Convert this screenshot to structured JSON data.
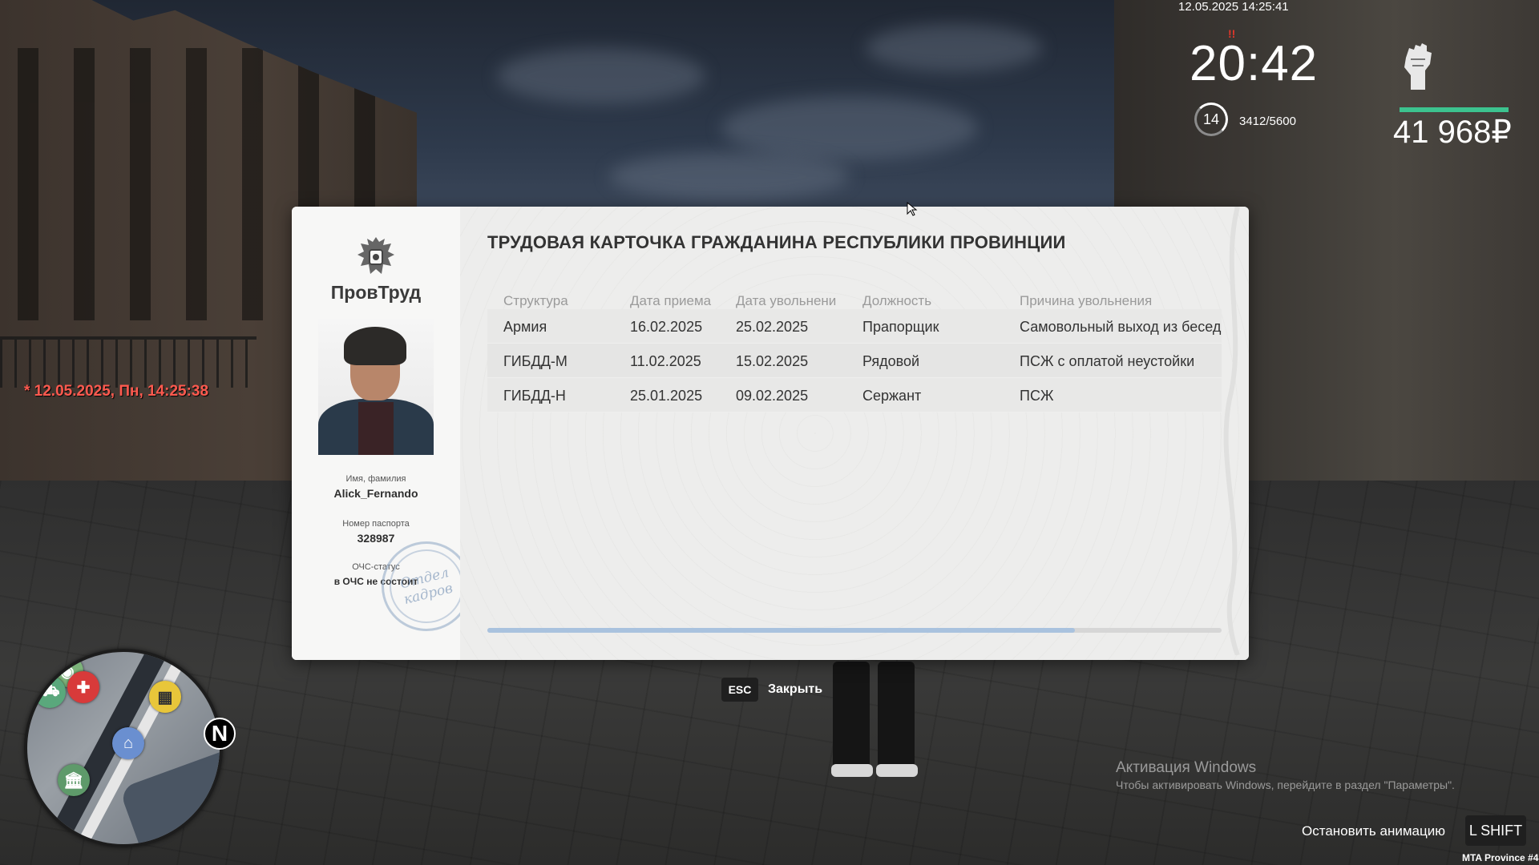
{
  "hud": {
    "datetime_top": "12.05.2025 14:25:41",
    "clock": "20:42",
    "clock_mark": "!!",
    "level": "14",
    "xp": "3412/5600",
    "money": "41 968₽",
    "red_datetime": "* 12.05.2025, Пн, 14:25:38",
    "health_fraction": 1.0,
    "colors": {
      "health": "#3cc38f",
      "red_date": "#ff5a4f"
    }
  },
  "minimap": {
    "north_label": "N",
    "icons": [
      "signal-icon",
      "car-icon",
      "medical-cross-icon",
      "taxi-icon",
      "police-icon",
      "bank-icon"
    ]
  },
  "dialog": {
    "brand": "ПровТруд",
    "title": "ТРУДОВАЯ КАРТОЧКА ГРАЖДАНИНА РЕСПУБЛИКИ ПРОВИНЦИИ",
    "name_label": "Имя, фамилия",
    "name_value": "Alick_Fernando",
    "passport_label": "Номер паспорта",
    "passport_value": "328987",
    "och_label": "ОЧС-статус",
    "och_value": "в ОЧС не состоит",
    "stamp_line1": "Отдел",
    "stamp_line2": "кадров",
    "columns": [
      "Структура",
      "Дата приема",
      "Дата увольнени",
      "Должность",
      "Причина увольнения"
    ],
    "rows": [
      [
        "Армия",
        "16.02.2025",
        "25.02.2025",
        "Прапорщик",
        "Самовольный выход из бесед"
      ],
      [
        "ГИБДД-М",
        "11.02.2025",
        "15.02.2025",
        "Рядовой",
        "ПСЖ с оплатой неустойки"
      ],
      [
        "ГИБДД-Н",
        "25.01.2025",
        "09.02.2025",
        "Сержант",
        "ПСЖ"
      ]
    ],
    "scroll_fraction": 0.8,
    "colors": {
      "scroll_thumb": "#a9c2de",
      "stamp": "#8ca5c3"
    }
  },
  "hints": {
    "esc_key": "ESC",
    "esc_label": "Закрыть",
    "stop_anim_label": "Остановить анимацию",
    "shift_key": "L SHIFT"
  },
  "watermark": {
    "title": "Активация Windows",
    "subtitle": "Чтобы активировать Windows, перейдите в раздел \"Параметры\"."
  },
  "server_name": "MTA Province #4"
}
